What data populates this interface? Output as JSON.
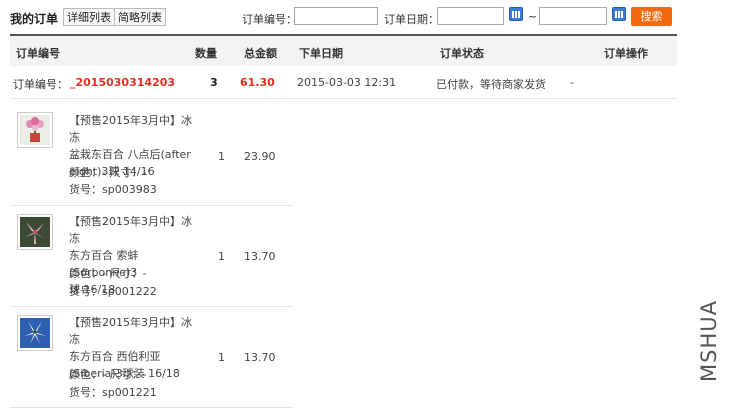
{
  "topbar": {
    "title": "我的订单",
    "view_detail": "详细列表",
    "view_simple": "简略列表",
    "order_no_label": "订单编号：",
    "order_date_label": "订单日期：",
    "date_sep": "~",
    "search_label": "搜索"
  },
  "table": {
    "headers": [
      "订单编号",
      "数量",
      "总金额",
      "下单日期",
      "订单状态",
      "订单操作"
    ]
  },
  "order": {
    "no_label": "订单编号：",
    "no_value": "_2015030314203",
    "qty": "3",
    "total": "61.30",
    "date": "2015-03-03 12:31",
    "status": "已付款，等待商家发货",
    "action": "-"
  },
  "items": [
    {
      "name_lines": [
        "【预售2015年3月中】冰冻",
        "盆栽东百合 八点后(after",
        "eight)3球 14/16"
      ],
      "attr": "颜色：- 尺寸：-",
      "sku": "货号：sp003983",
      "qty": "1",
      "price": "23.90"
    },
    {
      "name_lines": [
        "【预售2015年3月中】冰冻",
        "东方百合 索蚌(Sorbonne)3",
        "球 16/18"
      ],
      "attr": "颜色：- 尺寸：-",
      "sku": "货号：sp001222",
      "qty": "1",
      "price": "13.70"
    },
    {
      "name_lines": [
        "【预售2015年3月中】冰冻",
        "东方百合 西伯利亚",
        "(Siberia)3球装 16/18"
      ],
      "attr": "颜色：- 尺寸：-",
      "sku": "货号：sp001221",
      "qty": "1",
      "price": "13.70"
    }
  ],
  "watermark": "MSHUA",
  "colors": {
    "accent": "#f26a10",
    "order_no": "#e0301e",
    "header_bg": "#f3f3f3"
  }
}
